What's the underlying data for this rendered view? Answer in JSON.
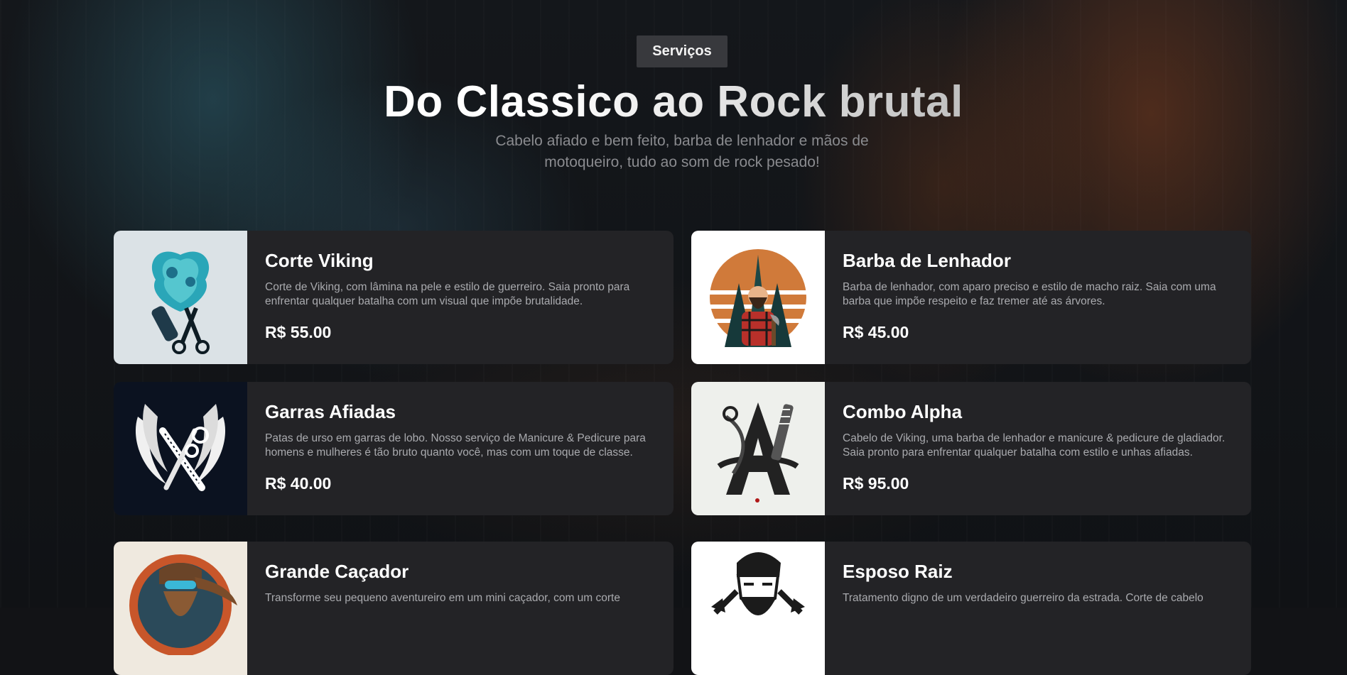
{
  "section": {
    "badge": "Serviços",
    "title": "Do Classico ao Rock brutal",
    "subtitle": "Cabelo afiado e bem feito, barba de lenhador e mãos de motoqueiro, tudo ao som de rock pesado!"
  },
  "services": [
    {
      "name": "Corte Viking",
      "description": "Corte de Viking, com lâmina na pele e estilo de guerreiro. Saia pronto para enfrentar qualquer batalha com um visual que impõe brutalidade.",
      "price": "R$ 55.00",
      "icon": "viking-scissors-icon"
    },
    {
      "name": "Barba de Lenhador",
      "description": "Barba de lenhador, com aparo preciso e estilo de macho raiz. Saia com uma barba que impõe respeito e faz tremer até as árvores.",
      "price": "R$ 45.00",
      "icon": "lumberjack-icon"
    },
    {
      "name": "Garras Afiadas",
      "description": "Patas de urso em garras de lobo. Nosso serviço de Manicure & Pedicure para homens e mulheres é tão bruto quanto você, mas com um toque de classe.",
      "price": "R$ 40.00",
      "icon": "claws-icon"
    },
    {
      "name": "Combo Alpha",
      "description": "Cabelo de Viking, uma barba de lenhador e manicure & pedicure de gladiador. Saia pronto para enfrentar qualquer batalha com estilo e unhas afiadas.",
      "price": "R$ 95.00",
      "icon": "alpha-letter-icon"
    },
    {
      "name": "Grande Caçador",
      "description": "Transforme seu pequeno aventureiro em um mini caçador, com um corte",
      "price": "",
      "icon": "bearded-hunter-icon"
    },
    {
      "name": "Esposo Raiz",
      "description": "Tratamento digno de um verdadeiro guerreiro da estrada. Corte de cabelo",
      "price": "",
      "icon": "bearded-man-axes-icon"
    }
  ]
}
